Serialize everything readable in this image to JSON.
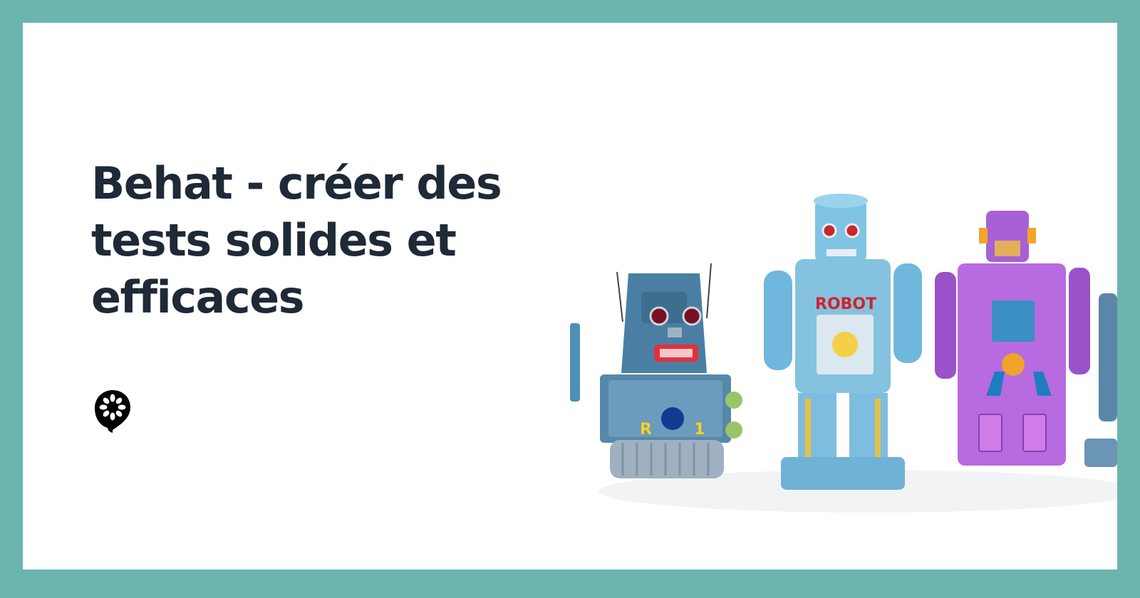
{
  "article": {
    "title": "Behat - créer des tests solides et efficaces"
  },
  "logo": {
    "icon": "cucumber-logo-icon",
    "color": "#000000"
  },
  "image": {
    "subject": "vintage-tin-toy-robots",
    "robot_labels": [
      "R",
      "1",
      "ROBOT"
    ]
  },
  "colors": {
    "frame": "#6bb5ad",
    "card": "#ffffff",
    "title": "#1f2937"
  }
}
